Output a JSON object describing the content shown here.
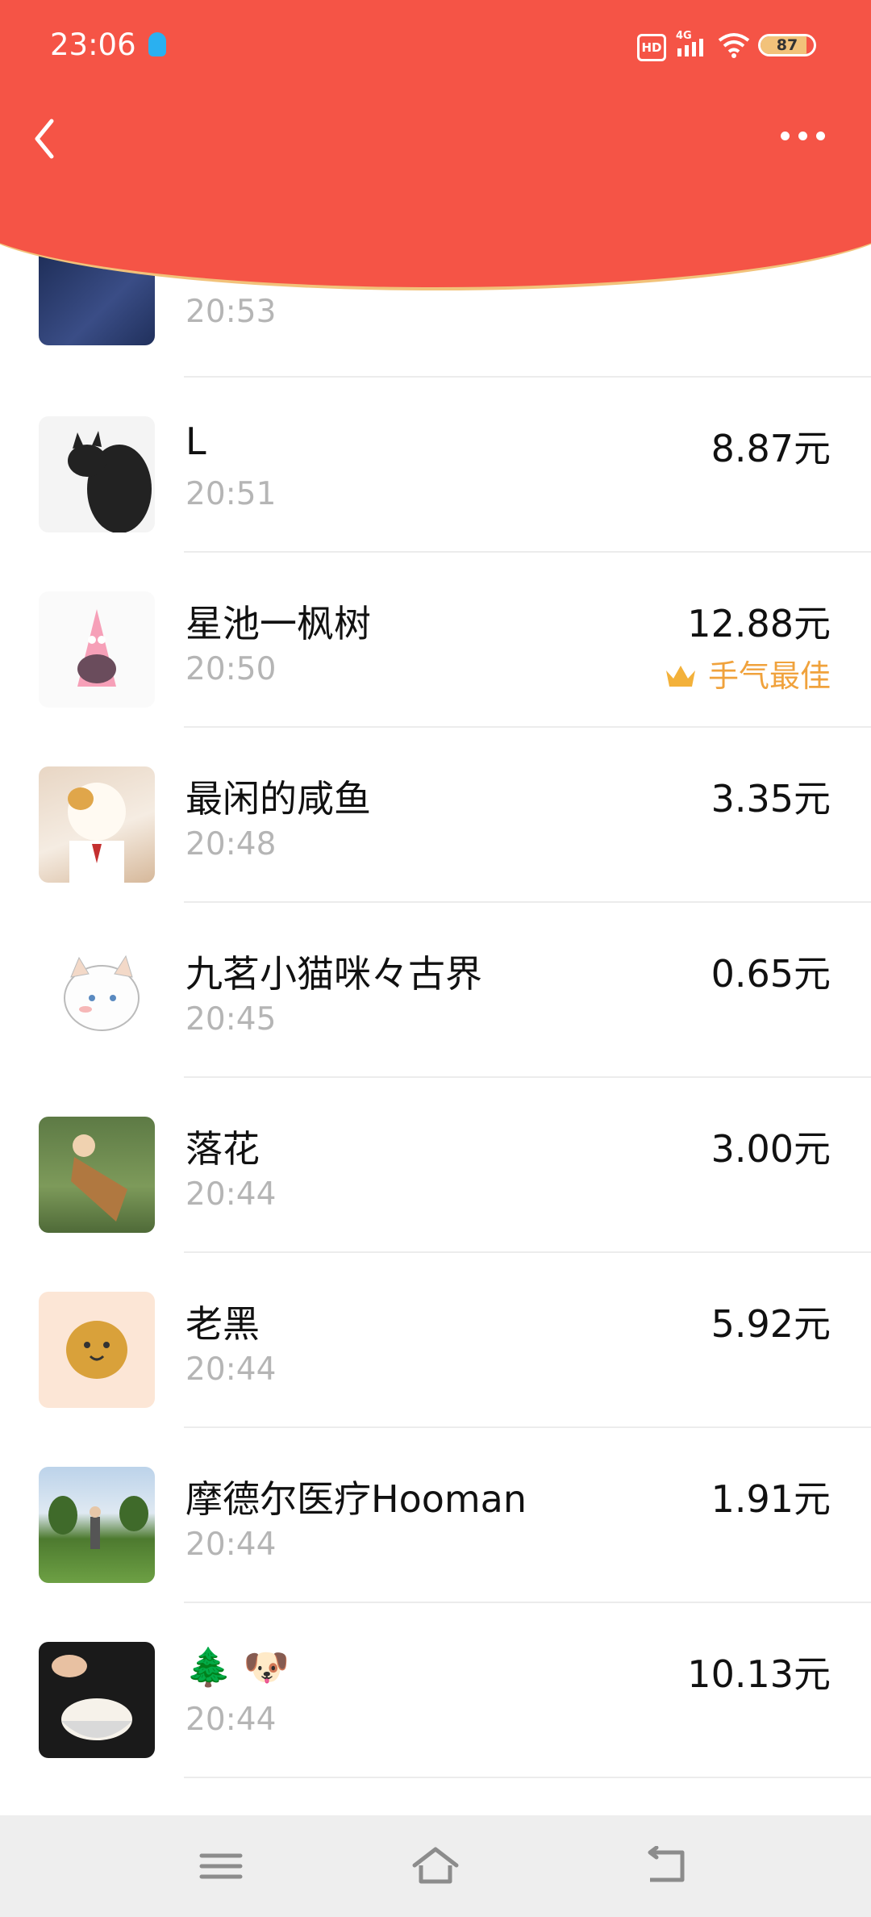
{
  "status": {
    "time": "23:06",
    "battery": "87",
    "battery_level": 0.87,
    "hd": "HD",
    "network": "4G"
  },
  "header": {
    "background_color": "#F55446",
    "icons": [
      "back-icon",
      "more-icon"
    ]
  },
  "packets": [
    {
      "name": "",
      "time": "20:53",
      "amount": "",
      "best": ""
    },
    {
      "name": "L",
      "time": "20:51",
      "amount": "8.87元",
      "best": ""
    },
    {
      "name": "星池一枫树",
      "time": "20:50",
      "amount": "12.88元",
      "best": "手气最佳"
    },
    {
      "name": "最闲的咸鱼",
      "time": "20:48",
      "amount": "3.35元",
      "best": ""
    },
    {
      "name": "九茗小猫咪々古界",
      "time": "20:45",
      "amount": "0.65元",
      "best": ""
    },
    {
      "name": "落花",
      "time": "20:44",
      "amount": "3.00元",
      "best": ""
    },
    {
      "name": "老黑",
      "time": "20:44",
      "amount": "5.92元",
      "best": ""
    },
    {
      "name": "摩德尔医疗Hooman",
      "time": "20:44",
      "amount": "1.91元",
      "best": ""
    },
    {
      "name": "🌲 🐶",
      "time": "20:44",
      "amount": "10.13元",
      "best": ""
    }
  ],
  "bottom_nav": [
    "menu-icon",
    "home-icon",
    "back-nav-icon"
  ],
  "colors": {
    "accent": "#F55446",
    "best": "#F0A23C",
    "muted": "#B5B5B5"
  }
}
